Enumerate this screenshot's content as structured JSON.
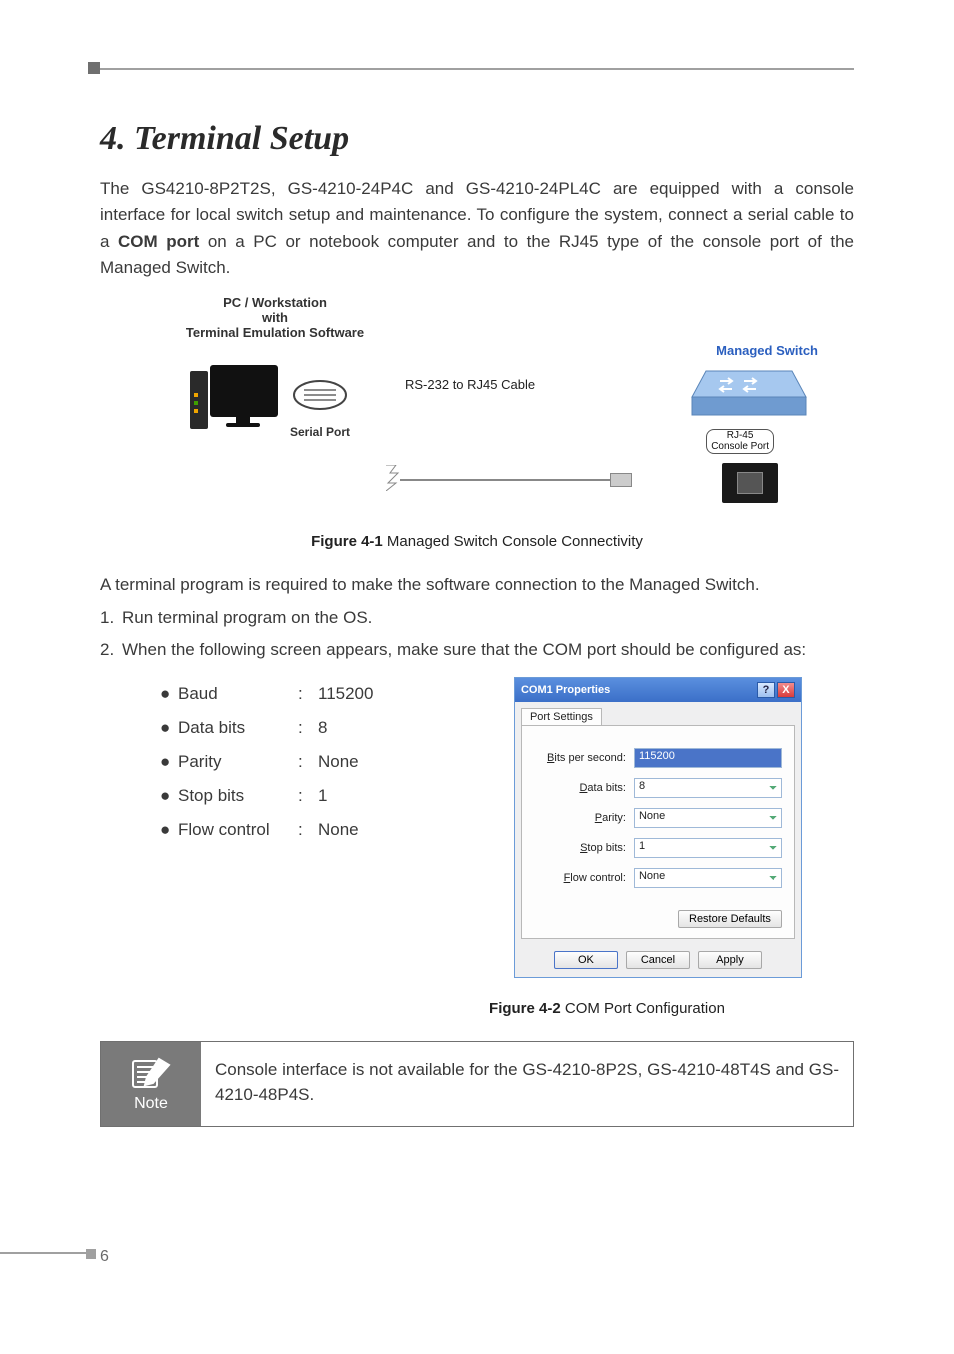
{
  "heading": "4. Terminal Setup",
  "para1_pre": "The GS4210-8P2T2S, GS-4210-24P4C and GS-4210-24PL4C are equipped with a console interface for local switch setup and maintenance. To configure the system, connect a serial cable to a ",
  "para1_bold": "COM port",
  "para1_post": " on a PC or notebook computer and to the RJ45 type of the console port of the Managed Switch.",
  "diagram": {
    "pc_label_l1": "PC / Workstation",
    "pc_label_l2": "with",
    "pc_label_l3": "Terminal Emulation Software",
    "serial_port": "Serial Port",
    "cable": "RS-232 to RJ45 Cable",
    "switch_label": "Managed Switch",
    "rj_l1": "RJ-45",
    "rj_l2": "Console Port"
  },
  "fig1_b": "Figure 4-1",
  "fig1_t": "  Managed Switch Console Connectivity",
  "para2": "A terminal program is required to make the software connection to the Managed Switch.",
  "step1_n": "1.",
  "step1_t": "Run terminal program on the OS.",
  "step2_n": "2.",
  "step2_t": "When the following screen appears, make sure that the COM port should be configured as:",
  "settings": [
    {
      "label": "Baud",
      "value": "115200"
    },
    {
      "label": "Data bits",
      "value": "8"
    },
    {
      "label": "Parity",
      "value": "None"
    },
    {
      "label": "Stop bits",
      "value": "1"
    },
    {
      "label": "Flow control",
      "value": "None"
    }
  ],
  "dialog": {
    "title": "COM1 Properties",
    "tab": "Port Settings",
    "fields": {
      "bps_label": "Bits per second:",
      "bps_value": "115200",
      "data_label": "Data bits:",
      "data_value": "8",
      "parity_label": "Parity:",
      "parity_value": "None",
      "stop_label": "Stop bits:",
      "stop_value": "1",
      "flow_label": "Flow control:",
      "flow_value": "None"
    },
    "restore": "Restore Defaults",
    "ok": "OK",
    "cancel": "Cancel",
    "apply": "Apply"
  },
  "fig2_b": "Figure 4-2",
  "fig2_t": "  COM Port Configuration",
  "note_label": "Note",
  "note_text": "Console interface is not available for the GS-4210-8P2S, GS-4210-48T4S and GS-4210-48P4S.",
  "page_number": "6"
}
